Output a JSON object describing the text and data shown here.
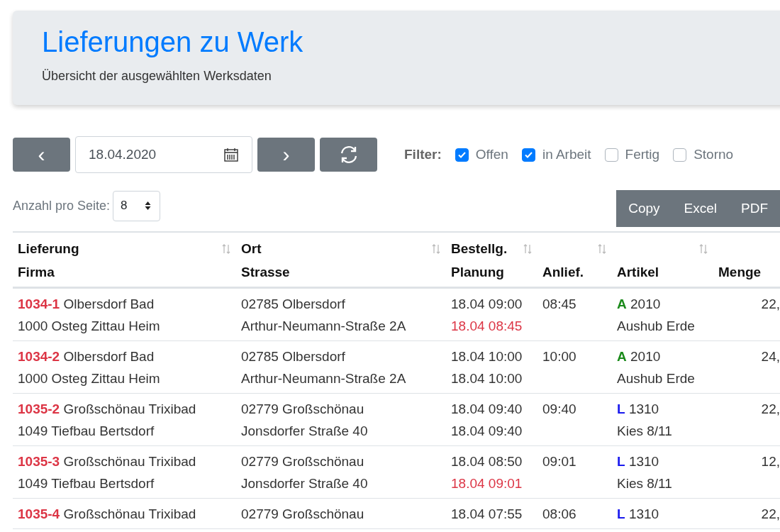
{
  "header": {
    "title": "Lieferungen zu Werk",
    "subtitle": "Übersicht der ausgewählten Werksdaten"
  },
  "toolbar": {
    "prev": "‹",
    "date": "18.04.2020",
    "next": "›",
    "filter_label": "Filter:",
    "filters": [
      {
        "label": "Offen",
        "checked": true
      },
      {
        "label": "in Arbeit",
        "checked": true
      },
      {
        "label": "Fertig",
        "checked": false
      },
      {
        "label": "Storno",
        "checked": false
      }
    ]
  },
  "page_size": {
    "label": "Anzahl pro Seite:",
    "value": "8"
  },
  "export_buttons": [
    "Copy",
    "Excel",
    "PDF"
  ],
  "table": {
    "columns": [
      {
        "top": "Lieferung",
        "bottom": "Firma",
        "sort_icon": true
      },
      {
        "top": "Ort",
        "bottom": "Strasse",
        "sort_icon": true
      },
      {
        "top": "Bestellg.",
        "bottom": "Planung",
        "sort_icon": true
      },
      {
        "bottom": "Anlief.",
        "sort_icon": true
      },
      {
        "bottom": "Artikel",
        "sort_icon": true
      },
      {
        "bottom": "Menge",
        "sort_icon": false
      }
    ],
    "rows": [
      {
        "id": "1034-1",
        "site": "Olbersdorf Bad",
        "firma": "1000 Osteg Zittau Heim",
        "ort": "02785 Olbersdorf",
        "strasse": "Arthur-Neumann-Straße 2A",
        "bestellg": "18.04 09:00",
        "planung": "18.04 08:45",
        "planung_late": true,
        "anlief": "08:45",
        "code": "A",
        "color": "#1a8a1a",
        "artikel_nr": "2010",
        "artikel": "Aushub Erde",
        "menge": "22,"
      },
      {
        "id": "1034-2",
        "site": "Olbersdorf Bad",
        "firma": "1000 Osteg Zittau Heim",
        "ort": "02785 Olbersdorf",
        "strasse": "Arthur-Neumann-Straße 2A",
        "bestellg": "18.04 10:00",
        "planung": "18.04 10:00",
        "planung_late": false,
        "anlief": "10:00",
        "code": "A",
        "color": "#1a8a1a",
        "artikel_nr": "2010",
        "artikel": "Aushub Erde",
        "menge": "24,"
      },
      {
        "id": "1035-2",
        "site": "Großschönau Trixibad",
        "firma": "1049 Tiefbau Bertsdorf",
        "ort": "02779 Großschönau",
        "strasse": "Jonsdorfer Straße 40",
        "bestellg": "18.04 09:40",
        "planung": "18.04 09:40",
        "planung_late": false,
        "anlief": "09:40",
        "code": "L",
        "color": "#1a1aee",
        "artikel_nr": "1310",
        "artikel": "Kies 8/11",
        "menge": "22,"
      },
      {
        "id": "1035-3",
        "site": "Großschönau Trixibad",
        "firma": "1049 Tiefbau Bertsdorf",
        "ort": "02779 Großschönau",
        "strasse": "Jonsdorfer Straße 40",
        "bestellg": "18.04 08:50",
        "planung": "18.04 09:01",
        "planung_late": true,
        "anlief": "09:01",
        "code": "L",
        "color": "#1a1aee",
        "artikel_nr": "1310",
        "artikel": "Kies 8/11",
        "menge": "12,"
      },
      {
        "id": "1035-4",
        "site": "Großschönau Trixibad",
        "ort": "02779 Großschönau",
        "bestellg": "18.04 07:55",
        "anlief": "08:06",
        "code": "L",
        "color": "#1a1aee",
        "artikel_nr": "1310",
        "menge": "22,"
      }
    ]
  }
}
